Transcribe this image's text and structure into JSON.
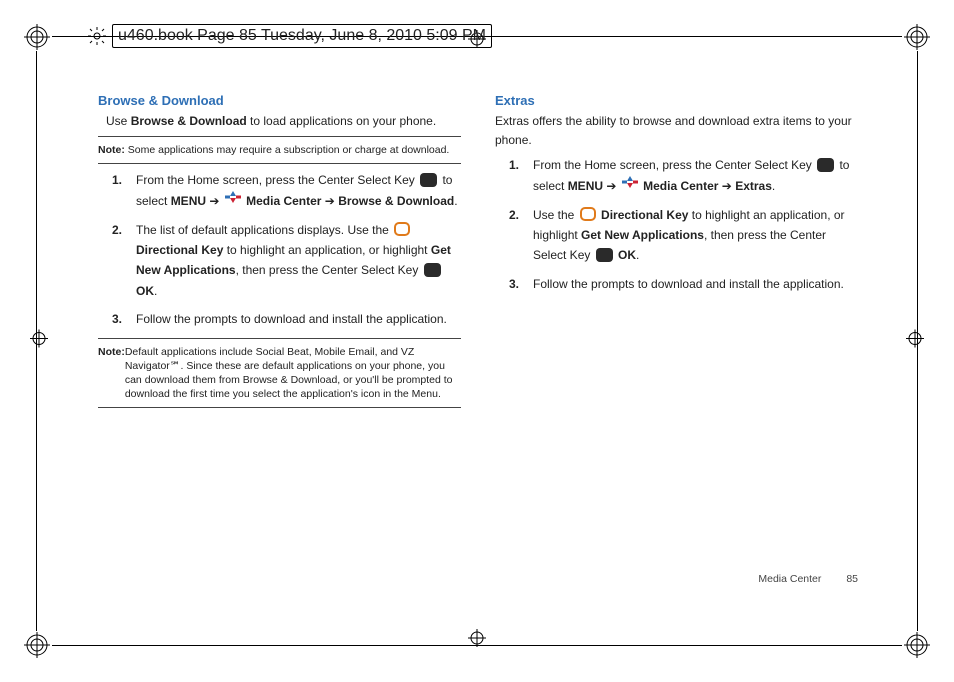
{
  "header": {
    "filetag": "u460.book  Page 85  Tuesday, June 8, 2010  5:09 PM"
  },
  "left": {
    "title": "Browse & Download",
    "intro_a": "Use ",
    "intro_b": "Browse & Download",
    "intro_c": " to load applications on your phone.",
    "note1_label": "Note:",
    "note1_text": " Some applications may require a subscription or charge at download.",
    "s1": {
      "num": "1.",
      "a": "From the Home screen, press the Center Select Key ",
      "b": " to select ",
      "menu": "MENU",
      "arrow1": " ➔ ",
      "mc": " Media Center",
      "arrow2": " ➔ ",
      "bd": "Browse & Download",
      "end": "."
    },
    "s2": {
      "num": "2.",
      "a": "The list of default applications displays. Use the ",
      "dk": "Directional Key",
      "b": " to highlight an application, or highlight ",
      "gna": "Get New Applications",
      "c": ", then press the Center Select Key ",
      "ok": "OK",
      "end": "."
    },
    "s3": {
      "num": "3.",
      "a": "Follow the prompts to download and install the application."
    },
    "note2_label": "Note:",
    "note2_text": " Default applications include Social Beat, Mobile Email, and VZ Navigator℠.  Since these are default applications on your phone, you can download them from Browse & Download, or you'll be prompted to download the first time you select the application's icon in the Menu."
  },
  "right": {
    "title": "Extras",
    "intro": "Extras offers the ability to browse and download extra items to your phone.",
    "s1": {
      "num": "1.",
      "a": "From the Home screen, press the Center Select Key ",
      "b": " to select ",
      "menu": "MENU",
      "arrow1": " ➔ ",
      "mc": " Media Center",
      "arrow2": " ➔ ",
      "ex": "Extras",
      "end": "."
    },
    "s2": {
      "num": "2.",
      "a": "Use the ",
      "dk": "Directional Key",
      "b": " to highlight an application, or highlight ",
      "gna": "Get New Applications",
      "c": ", then press the Center Select Key ",
      "ok": "OK",
      "end": "."
    },
    "s3": {
      "num": "3.",
      "a": "Follow the prompts to download and install the application."
    }
  },
  "footer": {
    "section": "Media Center",
    "page": "85"
  }
}
